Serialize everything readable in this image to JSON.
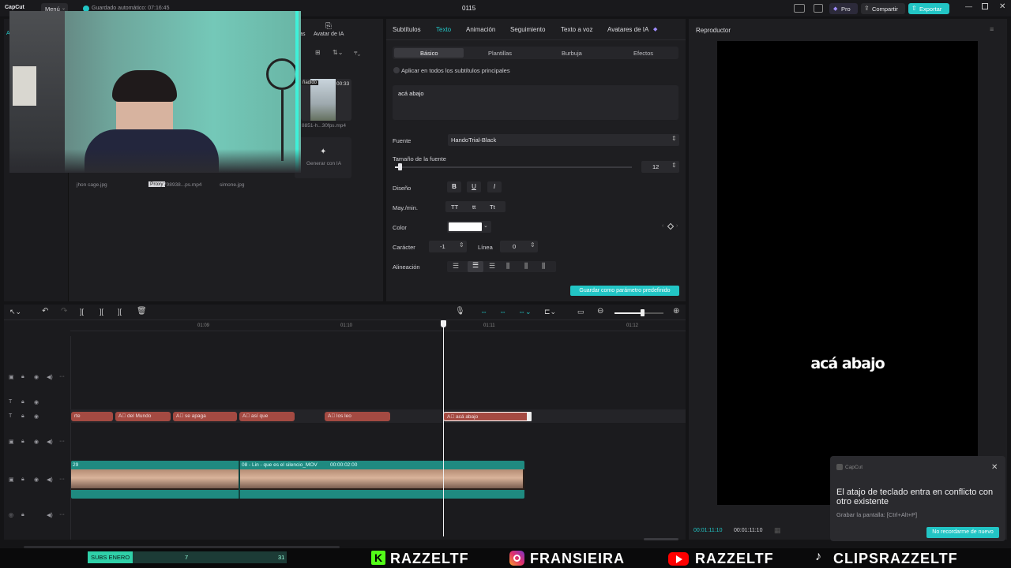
{
  "topbar": {
    "logo": "CapCut",
    "menu_label": "Menú",
    "autosave": "Guardado automático: 07:16:45",
    "project_title": "0115",
    "pro_label": "Pro",
    "share_label": "Compartir",
    "export_label": "Exportar"
  },
  "media": {
    "tab_partial": "llas",
    "tab_avatar": "Avatar de IA",
    "clip_badge": "ñadido",
    "clip_duration": "00:33",
    "clip_filename": "8851-h...30fps.mp4",
    "generate_ai": "Generar con IA",
    "files": [
      "jhon cage.jpg",
      "798938...ps.mp4",
      "simone.jpg"
    ],
    "proxy_badge": "Proxy",
    "webcam_label": "A"
  },
  "props": {
    "tabs": [
      "Subtítulos",
      "Texto",
      "Animación",
      "Seguimiento",
      "Texto a voz",
      "Avatares de IA"
    ],
    "active_tab": "Texto",
    "subtabs": [
      "Básico",
      "Plantillas",
      "Burbuja",
      "Efectos"
    ],
    "apply_all": "Aplicar en todos los subtítulos principales",
    "text_value": "acá abajo",
    "font_label": "Fuente",
    "font_value": "HandoTrial-Black",
    "size_label": "Tamaño de la fuente",
    "size_value": "12",
    "design_label": "Diseño",
    "design_b": "B",
    "design_u": "U",
    "design_i": "I",
    "case_label": "May./min.",
    "case_tt": "TT",
    "case_tt_lower": "tt",
    "case_title": "Tt",
    "color_label": "Color",
    "color_value": "#ffffff",
    "char_label": "Carácter",
    "char_value": "-1",
    "line_label": "Línea",
    "line_value": "0",
    "align_label": "Alineación",
    "save_default": "Guardar como parámetro predefinido"
  },
  "player": {
    "title": "Reproductor",
    "caption": "acá abajo",
    "time_current": "00:01:11:10",
    "time_total": "00:01:11:10"
  },
  "toast": {
    "app": "CapCut",
    "message": "El atajo de teclado entra en conflicto con otro existente",
    "detail": "Grabar la pantalla: [Ctrl+Alt+P]",
    "dismiss": "No recordarme de nuevo"
  },
  "timeline": {
    "ruler": [
      "01:09",
      "01:10",
      "01:11",
      "01:12"
    ],
    "text_clips": [
      {
        "label": "rte"
      },
      {
        "label": "del Mundo"
      },
      {
        "label": "se apaga"
      },
      {
        "label": "así que"
      },
      {
        "label": "los leo"
      },
      {
        "label": "acá abajo"
      }
    ],
    "video_left_label": "29",
    "video_clip_label": "08 - Lin - que es el silencio_MOV",
    "video_clip_time": "00:00:02:00"
  },
  "overlay": {
    "subs_label": "SUBS ENERO",
    "subs_current": "7",
    "subs_goal": "31",
    "subs_progress": 0.225,
    "socials": [
      {
        "icon": "kick-icon",
        "handle": "RAZZELTF",
        "color": "#53fc18"
      },
      {
        "icon": "instagram-icon",
        "handle": "FRANSIEIRA",
        "color": "#e1306c"
      },
      {
        "icon": "youtube-icon",
        "handle": "RAZZELTF",
        "color": "#ff0000"
      },
      {
        "icon": "tiktok-icon",
        "handle": "CLIPSRAZZELTF",
        "color": "#ffffff"
      }
    ]
  },
  "colors": {
    "accent": "#22c5c5",
    "text_clip": "#a44a42",
    "video_clip": "#1f8a80"
  }
}
